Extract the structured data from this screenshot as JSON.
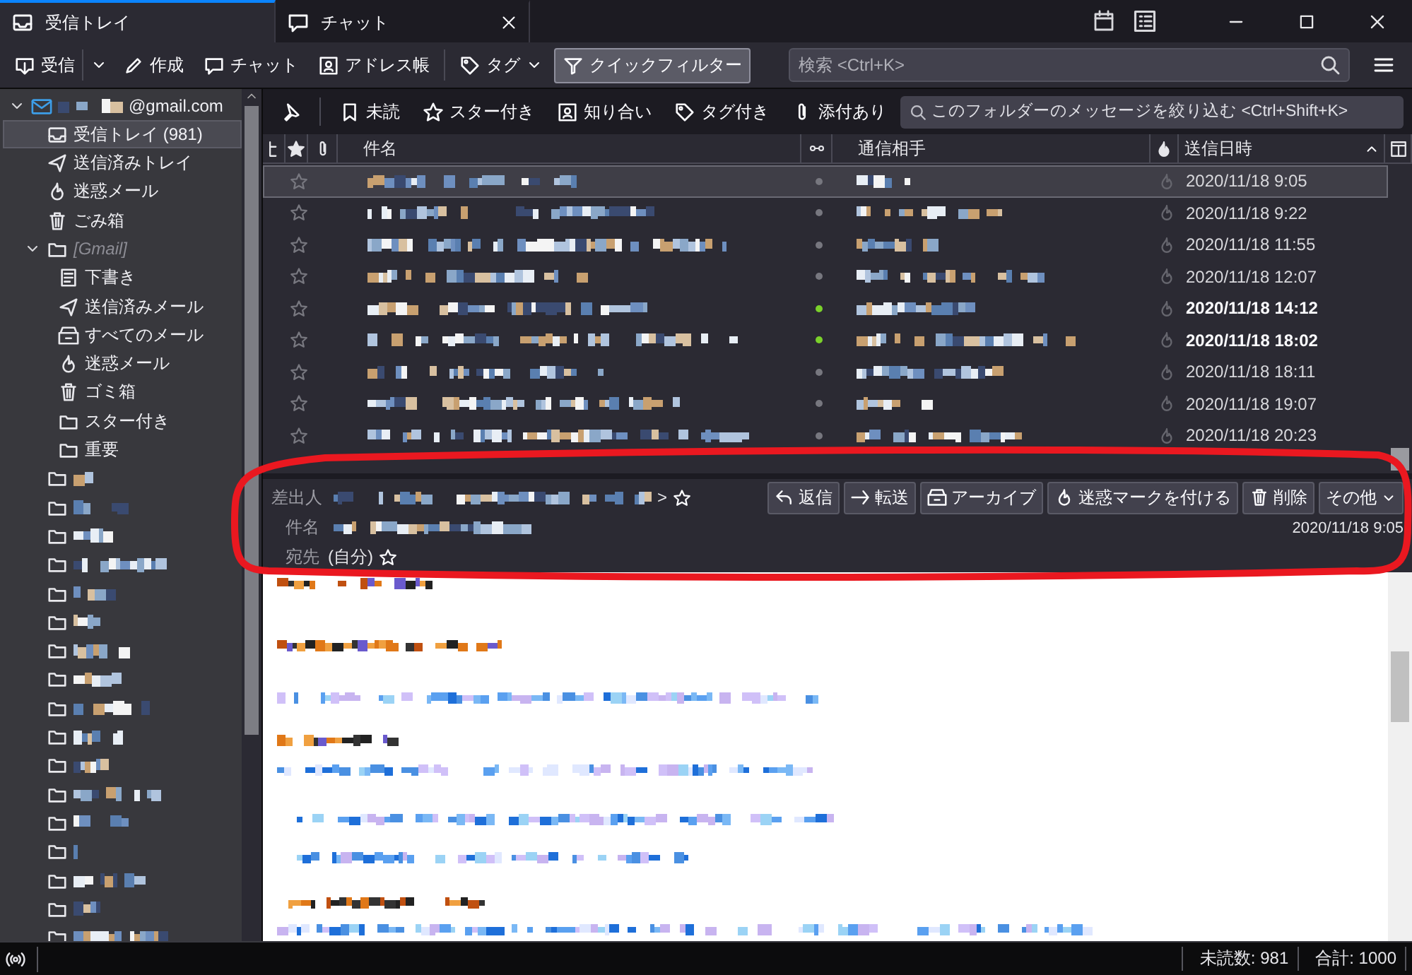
{
  "tabs": [
    {
      "label": "受信トレイ",
      "kind": "mail",
      "selected": true,
      "closable": false
    },
    {
      "label": "チャット",
      "kind": "chat",
      "selected": false,
      "closable": true
    }
  ],
  "toolbar": {
    "buttons": [
      {
        "label": "受信",
        "kind": "getmail",
        "dropdown": true,
        "on": false
      },
      {
        "label": "作成",
        "kind": "write",
        "dropdown": false,
        "on": false
      },
      {
        "label": "チャット",
        "kind": "chat",
        "dropdown": false,
        "on": false
      },
      {
        "label": "アドレス帳",
        "kind": "addressbook",
        "dropdown": false,
        "on": false
      },
      {
        "label": "タグ",
        "kind": "tag",
        "dropdown": true,
        "on": false
      },
      {
        "label": "クイックフィルター",
        "kind": "filter",
        "dropdown": false,
        "on": true
      }
    ],
    "search": {
      "placeholder": "検索 <Ctrl+K>"
    }
  },
  "sidebar": {
    "account": {
      "label": "@gmail.com",
      "kind": "account",
      "expanded": true,
      "selected": false,
      "children": [
        {
          "label": "受信トレイ (981)",
          "kind": "inbox",
          "selected": true
        },
        {
          "label": "送信済みトレイ",
          "kind": "sent",
          "selected": false
        },
        {
          "label": "迷惑メール",
          "kind": "junk",
          "selected": false
        },
        {
          "label": "ごみ箱",
          "kind": "trash",
          "selected": false
        },
        {
          "label": "[Gmail]",
          "kind": "virtual",
          "expanded": true,
          "selected": false,
          "children": [
            {
              "label": "下書き",
              "kind": "drafts",
              "selected": false
            },
            {
              "label": "送信済みメール",
              "kind": "sent",
              "selected": false
            },
            {
              "label": "すべてのメール",
              "kind": "archive",
              "selected": false
            },
            {
              "label": "迷惑メール",
              "kind": "junk",
              "selected": false
            },
            {
              "label": "ゴミ箱",
              "kind": "trash",
              "selected": false
            },
            {
              "label": "スター付き",
              "kind": "folder",
              "selected": false
            },
            {
              "label": "重要",
              "kind": "folder",
              "selected": false
            }
          ]
        },
        {
          "kind": "redacted",
          "selected": false
        },
        {
          "kind": "redacted",
          "selected": false
        },
        {
          "kind": "redacted",
          "selected": false
        },
        {
          "kind": "redacted",
          "selected": false
        },
        {
          "kind": "redacted",
          "selected": false
        },
        {
          "kind": "redacted",
          "selected": false
        },
        {
          "kind": "redacted",
          "selected": false
        },
        {
          "kind": "redacted",
          "selected": false
        },
        {
          "kind": "redacted",
          "selected": false
        },
        {
          "kind": "redacted",
          "selected": false
        },
        {
          "kind": "redacted",
          "selected": false
        },
        {
          "kind": "redacted",
          "selected": false
        },
        {
          "kind": "redacted",
          "selected": false
        },
        {
          "kind": "redacted",
          "selected": false
        },
        {
          "kind": "redacted",
          "selected": false
        },
        {
          "kind": "redacted",
          "selected": false
        },
        {
          "kind": "redacted",
          "selected": false
        }
      ]
    }
  },
  "quick_filter": {
    "buttons": [
      {
        "kind": "sticky",
        "on": false
      },
      {
        "label": "未読",
        "kind": "unread",
        "on": false
      },
      {
        "label": "スター付き",
        "kind": "starred",
        "on": false
      },
      {
        "label": "知り合い",
        "kind": "contact",
        "on": false
      },
      {
        "label": "タグ付き",
        "kind": "tag",
        "on": false
      },
      {
        "label": "添付あり",
        "kind": "attachment",
        "on": false
      }
    ],
    "filter": {
      "placeholder": "このフォルダーのメッセージを絞り込む <Ctrl+Shift+K>"
    }
  },
  "thread_columns": [
    {
      "kind": "thread"
    },
    {
      "kind": "star"
    },
    {
      "kind": "attachment"
    },
    {
      "label": "件名",
      "kind": "subject"
    },
    {
      "kind": "read"
    },
    {
      "label": "通信相手",
      "kind": "correspondent"
    },
    {
      "kind": "junk"
    },
    {
      "label": "送信日時",
      "kind": "date",
      "sort_ascending": true
    },
    {
      "kind": "picker"
    }
  ],
  "messages": [
    {
      "date": "2020/11/18 9:05",
      "unread": false,
      "starred": false,
      "selected": true
    },
    {
      "date": "2020/11/18 9:22",
      "unread": false,
      "starred": false,
      "selected": false
    },
    {
      "date": "2020/11/18 11:55",
      "unread": false,
      "starred": false,
      "selected": false
    },
    {
      "date": "2020/11/18 12:07",
      "unread": false,
      "starred": false,
      "selected": false
    },
    {
      "date": "2020/11/18 14:12",
      "unread": true,
      "starred": false,
      "selected": false
    },
    {
      "date": "2020/11/18 18:02",
      "unread": true,
      "starred": false,
      "selected": false
    },
    {
      "date": "2020/11/18 18:11",
      "unread": false,
      "starred": false,
      "selected": false
    },
    {
      "date": "2020/11/18 19:07",
      "unread": false,
      "starred": false,
      "selected": false
    },
    {
      "date": "2020/11/18 20:23",
      "unread": false,
      "starred": false,
      "selected": false
    }
  ],
  "message_header": {
    "from_label": "差出人",
    "from_tail": ">",
    "subject_label": "件名",
    "to_label": "宛先",
    "to": "(自分)",
    "date": "2020/11/18 9:05",
    "buttons": [
      {
        "label": "返信",
        "kind": "reply",
        "dropdown": false
      },
      {
        "label": "転送",
        "kind": "forward",
        "dropdown": false
      },
      {
        "label": "アーカイブ",
        "kind": "archive",
        "dropdown": false
      },
      {
        "label": "迷惑マークを付ける",
        "kind": "junk",
        "dropdown": false
      },
      {
        "label": "削除",
        "kind": "trash",
        "dropdown": false
      },
      {
        "label": "その他",
        "kind": "more",
        "dropdown": true
      }
    ]
  },
  "status_bar": {
    "unread": "未読数: 981",
    "total": "合計: 1000"
  }
}
